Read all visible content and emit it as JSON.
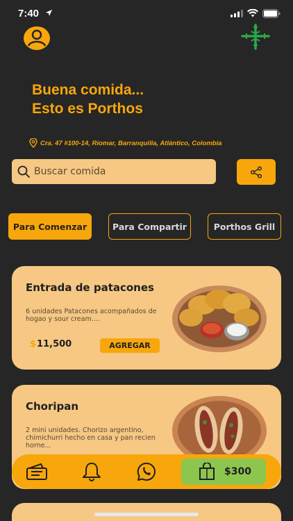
{
  "status_bar": {
    "time": "7:40",
    "icons": [
      "location-arrow-icon",
      "signal-icon",
      "wifi-icon",
      "battery-icon"
    ]
  },
  "header": {
    "profile_icon": "user-circle-icon",
    "logo_icon": "porthos-cross-logo"
  },
  "hero": {
    "line1": "Buena comida...",
    "line2": "Esto es Porthos",
    "address": "Cra. 47 #100-14, Riomar, Barranquilla, Atlántico, Colombia",
    "address_icon": "map-pin-icon"
  },
  "search": {
    "placeholder": "Buscar comida",
    "value": "",
    "icon": "search-icon",
    "share_icon": "share-icon"
  },
  "categories": [
    {
      "label": "Para Comenzar",
      "active": true
    },
    {
      "label": "Para Compartir",
      "active": false
    },
    {
      "label": "Porthos Grill",
      "active": false
    }
  ],
  "products": [
    {
      "title": "Entrada de patacones",
      "description": "6 unidades Patacones acompañados de hogao y sour cream....",
      "currency": "$",
      "price": "11,500",
      "add_label": "AGREGAR"
    },
    {
      "title": "Choripan",
      "description": "2 mini unidades. Chorizo argentino, chimichurri hecho en casa y pan recien horne..."
    }
  ],
  "bottom_nav": {
    "items": [
      "menu-card-icon",
      "bell-icon",
      "whatsapp-icon"
    ],
    "cart_icon": "shopping-bag-icon",
    "cart_total": "$300"
  },
  "colors": {
    "background": "#262626",
    "accent": "#f7a70c",
    "card": "#f6c884",
    "cart": "#8dc64e"
  }
}
